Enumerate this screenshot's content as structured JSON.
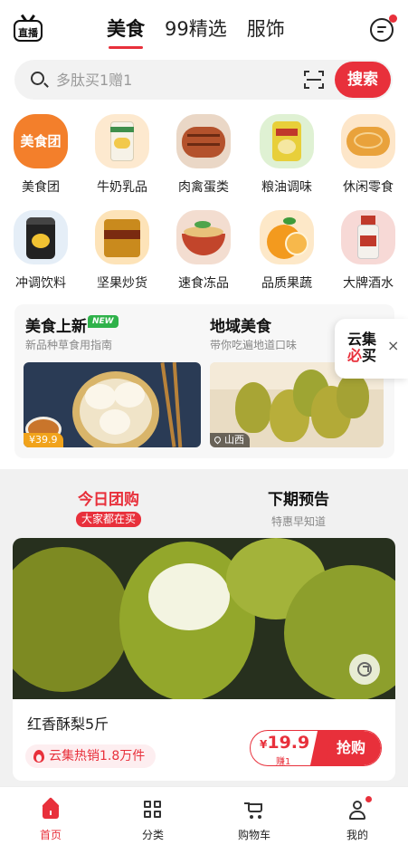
{
  "header": {
    "live_label": "直播",
    "tabs": [
      {
        "label": "美食",
        "active": true
      },
      {
        "label": "99精选",
        "active": false
      },
      {
        "label": "服饰",
        "active": false
      }
    ]
  },
  "search": {
    "placeholder": "多肽买1赠1",
    "button_label": "搜索"
  },
  "categories": [
    {
      "label": "美食团",
      "icon": "meishituan-logo",
      "icon_text": "美食团"
    },
    {
      "label": "牛奶乳品",
      "icon": "milk-powder-icon"
    },
    {
      "label": "肉禽蛋类",
      "icon": "grilled-meat-icon"
    },
    {
      "label": "粮油调味",
      "icon": "rice-bag-icon"
    },
    {
      "label": "休闲零食",
      "icon": "pastry-icon"
    },
    {
      "label": "冲调饮料",
      "icon": "drink-can-icon"
    },
    {
      "label": "坚果炒货",
      "icon": "nut-box-icon"
    },
    {
      "label": "速食冻品",
      "icon": "noodle-bowl-icon"
    },
    {
      "label": "品质果蔬",
      "icon": "orange-icon"
    },
    {
      "label": "大牌酒水",
      "icon": "liquor-bottle-icon"
    }
  ],
  "promo": {
    "left": {
      "title": "美食上新",
      "badge": "NEW",
      "subtitle": "新品种草食用指南",
      "tag": "¥39.9"
    },
    "right": {
      "title": "地域美食",
      "subtitle": "带你吃遍地道口味",
      "tag": "山西"
    }
  },
  "floating_ad": {
    "line1": "云集",
    "line2a": "必",
    "line2b": "买",
    "close": "×"
  },
  "group_buy": {
    "tab_today": {
      "title": "今日团购",
      "subtitle": "大家都在买"
    },
    "tab_next": {
      "title": "下期预告",
      "subtitle": "特惠早知道"
    }
  },
  "product": {
    "name": "红香酥梨5斤",
    "hot_text": "云集热销1.8万件",
    "currency": "¥",
    "price": "19.9",
    "earn": "赚1",
    "buy_label": "抢购"
  },
  "bottom_nav": [
    {
      "label": "首页",
      "icon": "home-icon",
      "active": true
    },
    {
      "label": "分类",
      "icon": "grid-icon",
      "active": false
    },
    {
      "label": "购物车",
      "icon": "cart-icon",
      "active": false
    },
    {
      "label": "我的",
      "icon": "profile-icon",
      "active": false
    }
  ],
  "colors": {
    "accent": "#e8303b",
    "new_badge": "#2fb24a"
  }
}
